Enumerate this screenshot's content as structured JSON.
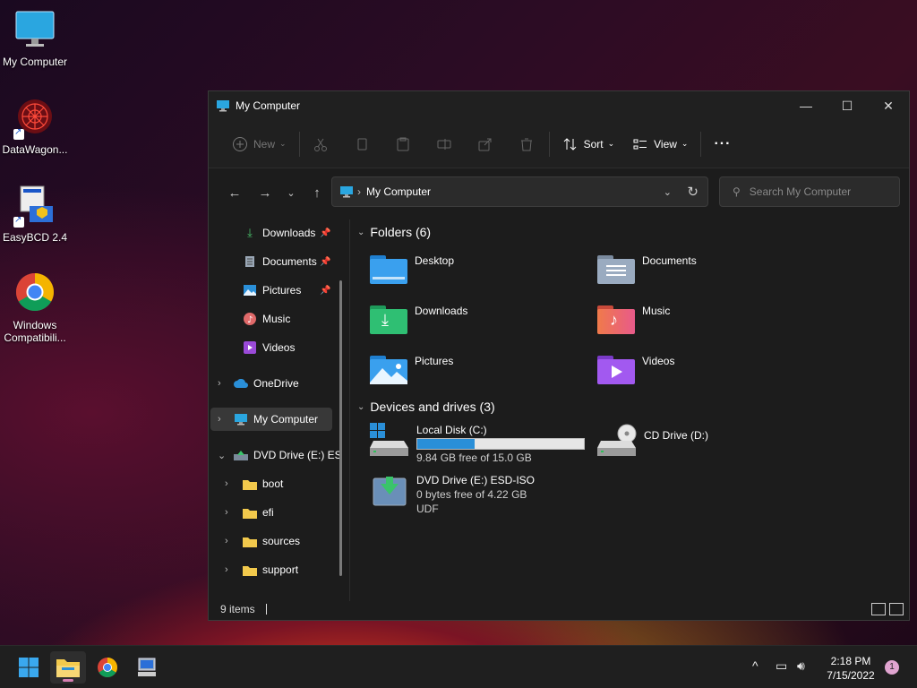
{
  "desktop": {
    "icons": [
      {
        "label": "My Computer"
      },
      {
        "label": "DataWagon..."
      },
      {
        "label": "EasyBCD 2.4"
      },
      {
        "label": "Windows\nCompatibili..."
      }
    ]
  },
  "window": {
    "title": "My Computer",
    "controls": {
      "minimize": "—",
      "maximize": "☐",
      "close": "✕"
    }
  },
  "commandbar": {
    "new_label": "New",
    "sort_label": "Sort",
    "view_label": "View",
    "more_label": "···"
  },
  "address": {
    "crumb": "My Computer",
    "search_placeholder": "Search My Computer"
  },
  "nav": {
    "quick": [
      {
        "label": "Downloads",
        "pinned": true
      },
      {
        "label": "Documents",
        "pinned": true
      },
      {
        "label": "Pictures",
        "pinned": true
      },
      {
        "label": "Music"
      },
      {
        "label": "Videos"
      }
    ],
    "onedrive": "OneDrive",
    "mycomputer": "My Computer",
    "dvd": "DVD Drive (E:) ES",
    "dvd_children": [
      "boot",
      "efi",
      "sources",
      "support"
    ]
  },
  "content": {
    "folders_header": "Folders (6)",
    "folders": [
      {
        "name": "Desktop"
      },
      {
        "name": "Documents"
      },
      {
        "name": "Downloads"
      },
      {
        "name": "Music"
      },
      {
        "name": "Pictures"
      },
      {
        "name": "Videos"
      }
    ],
    "devices_header": "Devices and drives (3)",
    "drives": [
      {
        "name": "Local Disk (C:)",
        "free": "9.84 GB free of 15.0 GB",
        "used_fraction": 0.344
      },
      {
        "name": "CD Drive (D:)"
      },
      {
        "name": "DVD Drive (E:) ESD-ISO",
        "free": "0 bytes free of 4.22 GB",
        "fs": "UDF"
      }
    ]
  },
  "status": {
    "items": "9 items"
  },
  "taskbar": {
    "time": "2:18 PM",
    "date": "7/15/2022",
    "notifications": "1"
  },
  "colors": {
    "accent": "#2a8fd8",
    "window_bg": "#1c1c1c",
    "taskbar_bg": "#1f1f1f"
  }
}
